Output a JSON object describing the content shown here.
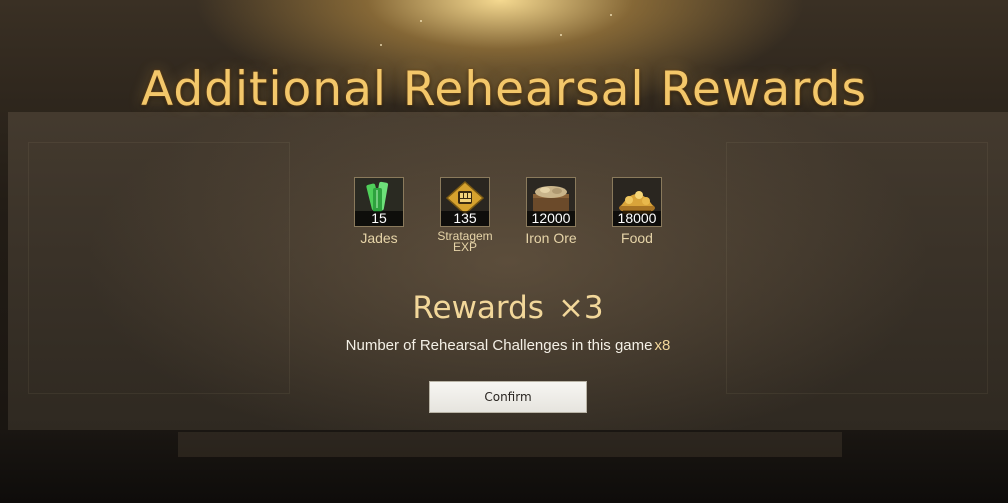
{
  "dialog": {
    "title": "Additional Rehearsal Rewards",
    "rewards": [
      {
        "icon": "jade-icon",
        "quantity": "15",
        "label": "Jades"
      },
      {
        "icon": "stratagem-exp-icon",
        "quantity": "135",
        "label": "Stratagem EXP"
      },
      {
        "icon": "iron-ore-icon",
        "quantity": "12000",
        "label": "Iron Ore"
      },
      {
        "icon": "food-icon",
        "quantity": "18000",
        "label": "Food"
      }
    ],
    "multiplier": {
      "label": "Rewards",
      "value": "×3"
    },
    "challenges": {
      "text": "Number of Rehearsal Challenges in this game",
      "count": "x8"
    },
    "confirm_label": "Confirm"
  },
  "colors": {
    "title_gold": "#f3c76a",
    "text_gold": "#f2d79a",
    "label_tan": "#e6d4a8",
    "button_bg": "#f0efea"
  }
}
